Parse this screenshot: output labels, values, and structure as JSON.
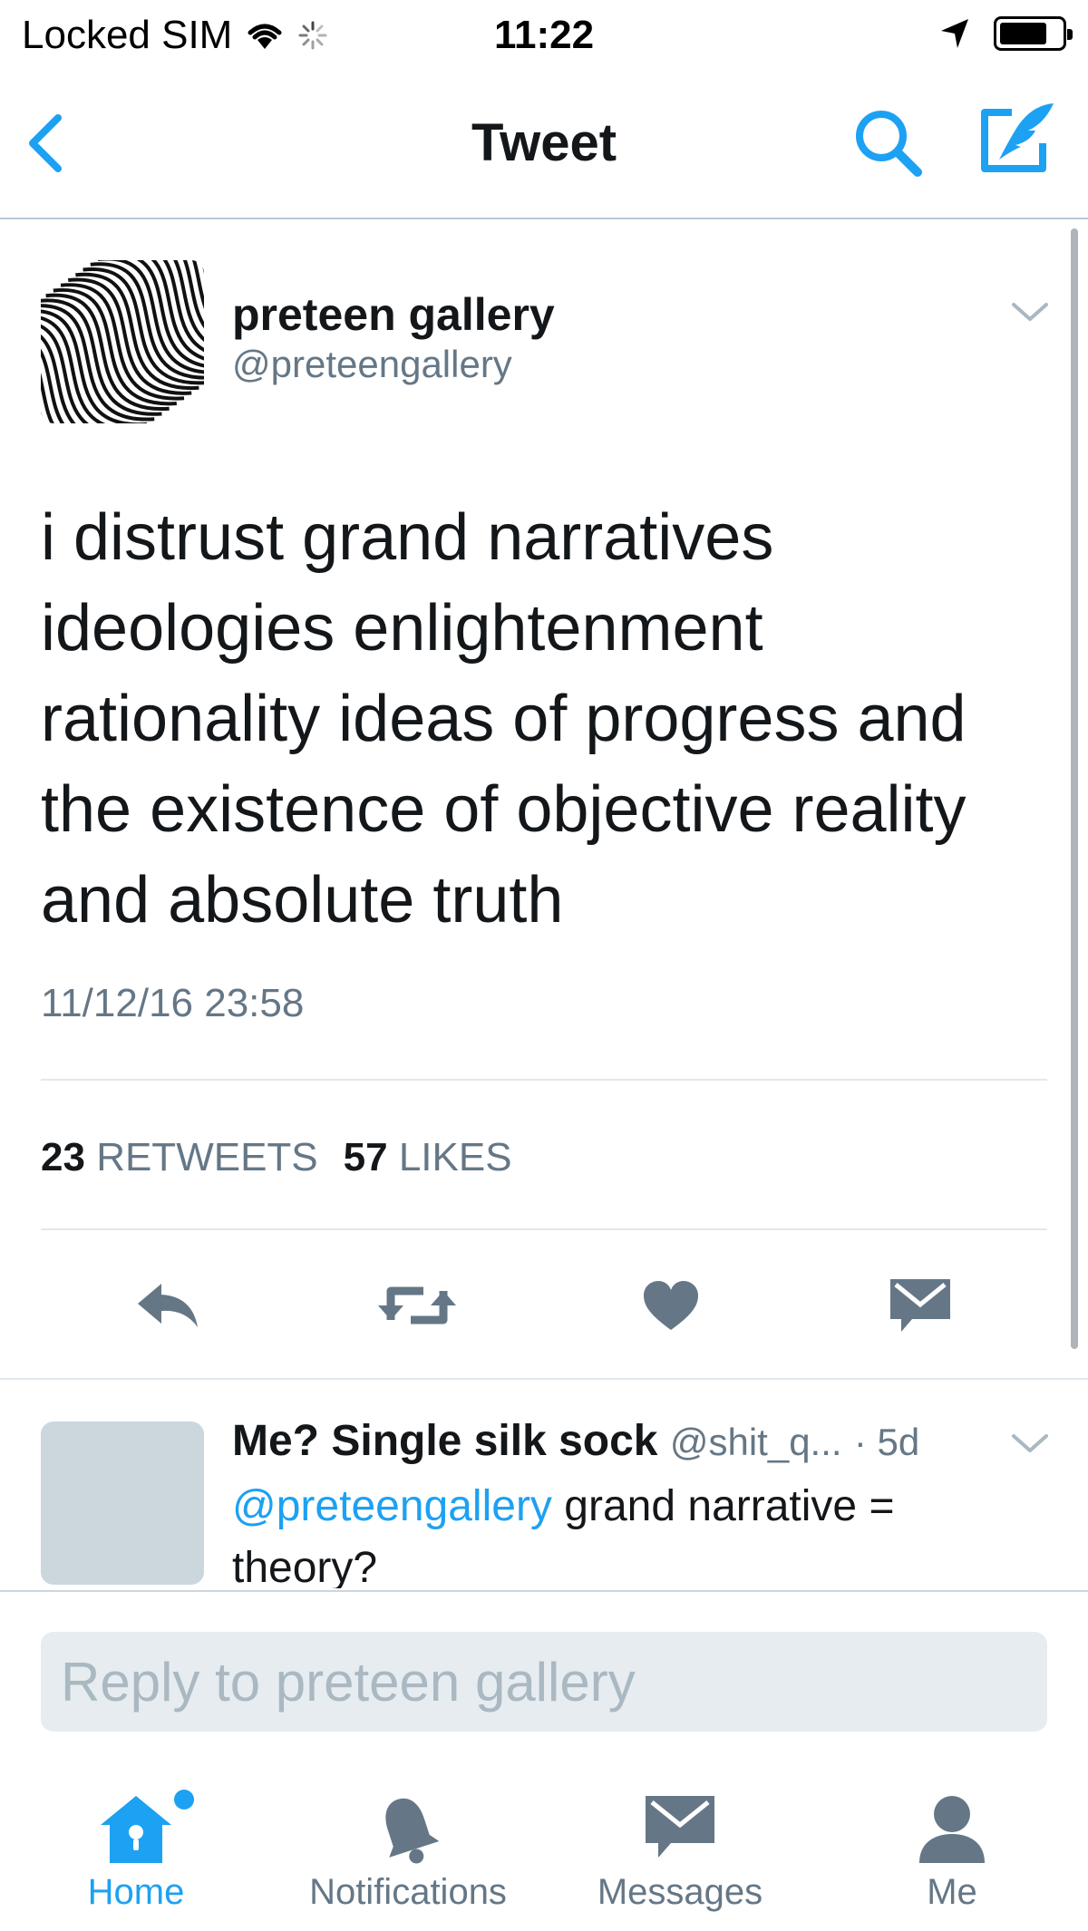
{
  "colors": {
    "accent": "#1da1f2",
    "secondary_text": "#657786",
    "primary_text": "#14171a",
    "icon_gray": "#657786",
    "divider": "#e1e8ed",
    "input_bg": "#e6ecf0"
  },
  "status_bar": {
    "carrier": "Locked SIM",
    "wifi_icon": "wifi-icon",
    "activity_icon": "activity-spinner-icon",
    "time": "11:22",
    "location_icon": "location-arrow-icon",
    "battery_icon": "battery-icon",
    "battery_level": 0.78
  },
  "nav": {
    "back_icon": "chevron-left-icon",
    "title": "Tweet",
    "search_icon": "search-icon",
    "compose_icon": "compose-quill-icon"
  },
  "tweet": {
    "author_name": "preteen gallery",
    "author_handle": "@preteengallery",
    "avatar_icon": "op-art-stripes-avatar",
    "text": "i distrust grand narratives ideologies enlightenment rationality ideas of progress and the existence of objective reality and absolute truth",
    "timestamp": "11/12/16 23:58",
    "retweets_count": "23",
    "retweets_label": "RETWEETS",
    "likes_count": "57",
    "likes_label": "LIKES",
    "actions": {
      "reply_icon": "reply-icon",
      "retweet_icon": "retweet-icon",
      "like_icon": "heart-icon",
      "message_icon": "envelope-icon"
    }
  },
  "reply_preview": {
    "author_name": "Me? Single silk sock",
    "author_handle": "@shit_q...",
    "age": "· 5d",
    "mention": "@preteengallery",
    "text": "grand narrative = theory?"
  },
  "compose": {
    "placeholder": "Reply to preteen gallery"
  },
  "tab_bar": {
    "items": [
      {
        "label": "Home",
        "icon": "home-icon",
        "active": true
      },
      {
        "label": "Notifications",
        "icon": "bell-icon",
        "active": false
      },
      {
        "label": "Messages",
        "icon": "envelope-icon",
        "active": false
      },
      {
        "label": "Me",
        "icon": "person-icon",
        "active": false
      }
    ]
  }
}
